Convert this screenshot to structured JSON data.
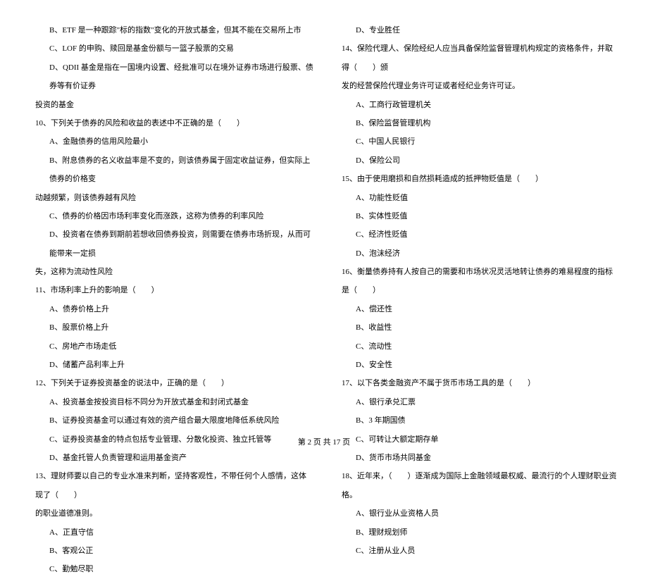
{
  "left_column": [
    {
      "indent": "indent-1",
      "text": "B、ETF 是一种跟踪\"标的指数\"变化的开放式基金，但其不能在交易所上市"
    },
    {
      "indent": "indent-1",
      "text": "C、LOF 的申购、赎回是基金份额与一篮子股票的交易"
    },
    {
      "indent": "indent-1",
      "text": "D、QDII 基金是指在一国境内设置、经批准可以在境外证券市场进行股票、债券等有价证券"
    },
    {
      "indent": "no-indent",
      "text": "投资的基金"
    },
    {
      "indent": "no-indent",
      "text": "10、下列关于债券的风险和收益的表述中不正确的是（　　）"
    },
    {
      "indent": "indent-1",
      "text": "A、金融债券的信用风险最小"
    },
    {
      "indent": "indent-1",
      "text": "B、附息债券的名义收益率是不变的，则该债券属于固定收益证券，但实际上债券的价格变"
    },
    {
      "indent": "no-indent",
      "text": "动越频繁，则该债券越有风险"
    },
    {
      "indent": "indent-1",
      "text": "C、债券的价格因市场利率变化而涨跌，这称为债券的利率风险"
    },
    {
      "indent": "indent-1",
      "text": "D、投资者在债券到期前若想收回债券投资，则需要在债券市场折现，从而可能带来一定损"
    },
    {
      "indent": "no-indent",
      "text": "失，这称为流动性风险"
    },
    {
      "indent": "no-indent",
      "text": "11、市场利率上升的影响是（　　）"
    },
    {
      "indent": "indent-1",
      "text": "A、债券价格上升"
    },
    {
      "indent": "indent-1",
      "text": "B、股票价格上升"
    },
    {
      "indent": "indent-1",
      "text": "C、房地产市场走低"
    },
    {
      "indent": "indent-1",
      "text": "D、储蓄产品利率上升"
    },
    {
      "indent": "no-indent",
      "text": "12、下列关于证券投资基金的说法中，正确的是（　　）"
    },
    {
      "indent": "indent-1",
      "text": "A、投资基金按投资目标不同分为开放式基金和封闭式基金"
    },
    {
      "indent": "indent-1",
      "text": "B、证券投资基金可以通过有效的资产组合最大限度地降低系统风险"
    },
    {
      "indent": "indent-1",
      "text": "C、证券投资基金的特点包括专业管理、分散化投资、独立托管等"
    },
    {
      "indent": "indent-1",
      "text": "D、基金托管人负责管理和运用基金资产"
    },
    {
      "indent": "no-indent",
      "text": "13、理财师要以自己的专业水准来判断，坚持客观性，不带任何个人感情，这体现了（　　）"
    },
    {
      "indent": "no-indent",
      "text": "的职业道德准则。"
    },
    {
      "indent": "indent-1",
      "text": "A、正直守信"
    },
    {
      "indent": "indent-1",
      "text": "B、客观公正"
    },
    {
      "indent": "indent-1",
      "text": "C、勤勉尽职"
    }
  ],
  "right_column": [
    {
      "indent": "indent-1",
      "text": "D、专业胜任"
    },
    {
      "indent": "no-indent",
      "text": "14、保险代理人、保险经纪人应当具备保险监督管理机构规定的资格条件，并取得（　　）颁"
    },
    {
      "indent": "no-indent",
      "text": "发的经营保险代理业务许可证或者经纪业务许可证。"
    },
    {
      "indent": "indent-1",
      "text": "A、工商行政管理机关"
    },
    {
      "indent": "indent-1",
      "text": "B、保险监督管理机构"
    },
    {
      "indent": "indent-1",
      "text": "C、中国人民银行"
    },
    {
      "indent": "indent-1",
      "text": "D、保险公司"
    },
    {
      "indent": "no-indent",
      "text": "15、由于使用磨损和自然损耗造成的抵押物贬值是（　　）"
    },
    {
      "indent": "indent-1",
      "text": "A、功能性贬值"
    },
    {
      "indent": "indent-1",
      "text": "B、实体性贬值"
    },
    {
      "indent": "indent-1",
      "text": "C、经济性贬值"
    },
    {
      "indent": "indent-1",
      "text": "D、泡沫经济"
    },
    {
      "indent": "no-indent",
      "text": "16、衡量债券持有人按自己的需要和市场状况灵活地转让债券的难易程度的指标是（　　）"
    },
    {
      "indent": "indent-1",
      "text": "A、偿还性"
    },
    {
      "indent": "indent-1",
      "text": "B、收益性"
    },
    {
      "indent": "indent-1",
      "text": "C、流动性"
    },
    {
      "indent": "indent-1",
      "text": "D、安全性"
    },
    {
      "indent": "no-indent",
      "text": "17、以下各类金融资产不属于货币市场工具的是（　　）"
    },
    {
      "indent": "indent-1",
      "text": "A、银行承兑汇票"
    },
    {
      "indent": "indent-1",
      "text": "B、3 年期国债"
    },
    {
      "indent": "indent-1",
      "text": "C、可转让大额定期存单"
    },
    {
      "indent": "indent-1",
      "text": "D、货币市场共同基金"
    },
    {
      "indent": "no-indent",
      "text": "18、近年来，（　　）逐渐成为国际上金融领域最权威、最流行的个人理财职业资格。"
    },
    {
      "indent": "indent-1",
      "text": "A、银行业从业资格人员"
    },
    {
      "indent": "indent-1",
      "text": "B、理财规划师"
    },
    {
      "indent": "indent-1",
      "text": "C、注册从业人员"
    }
  ],
  "footer": "第 2 页 共 17 页"
}
